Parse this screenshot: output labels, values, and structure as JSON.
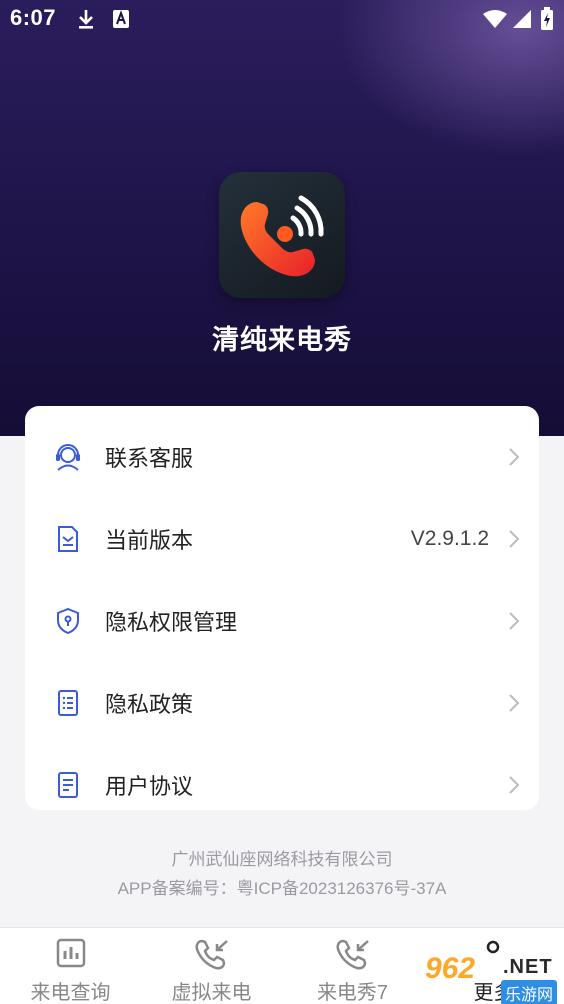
{
  "status_bar": {
    "time": "6:07"
  },
  "app": {
    "name": "清纯来电秀"
  },
  "menu": [
    {
      "label": "联系客服",
      "value": ""
    },
    {
      "label": "当前版本",
      "value": "V2.9.1.2"
    },
    {
      "label": "隐私权限管理",
      "value": ""
    },
    {
      "label": "隐私政策",
      "value": ""
    },
    {
      "label": "用户协议",
      "value": ""
    }
  ],
  "footer": {
    "company": "广州武仙座网络科技有限公司",
    "icp": "APP备案编号：粤ICP备2023126376号-37A"
  },
  "tabs": [
    {
      "label": "来电查询"
    },
    {
      "label": "虚拟来电"
    },
    {
      "label": "来电秀7"
    },
    {
      "label": "更多"
    }
  ],
  "watermark": {
    "num": "962",
    "net": ".NET",
    "cn": "乐游网"
  },
  "colors": {
    "hero_top": "#2b1d5c",
    "hero_bottom": "#150d36",
    "accent": "#3b5bdb",
    "logo_orange": "#ff5a1f"
  }
}
